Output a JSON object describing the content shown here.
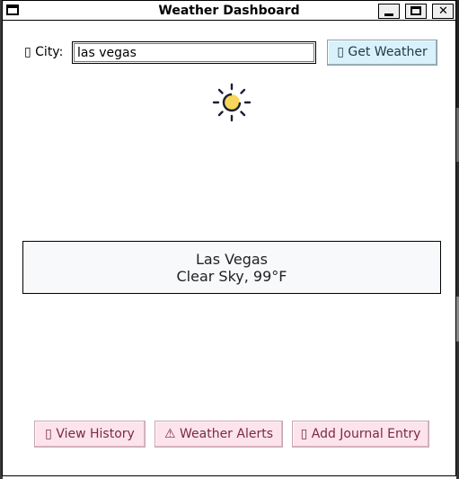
{
  "window": {
    "title": "Weather Dashboard",
    "minimize_glyph": "",
    "close_glyph": "✕"
  },
  "search": {
    "label": "▯ City:",
    "value": "las vegas",
    "button_label": "▯ Get Weather"
  },
  "weather": {
    "icon": "sun-icon",
    "city": "Las Vegas",
    "condition": "Clear Sky, 99°F"
  },
  "actions": {
    "history_label": "▯ View History",
    "alerts_label": "⚠ Weather Alerts",
    "journal_label": "▯ Add Journal Entry"
  },
  "colors": {
    "get_weather_bg": "#d8f1fb",
    "action_bg": "#fde4ec",
    "action_text": "#7a2a44",
    "sun_color": "#f6d75a",
    "sun_outline": "#1e1e32",
    "result_bg": "#f8f9fa"
  }
}
